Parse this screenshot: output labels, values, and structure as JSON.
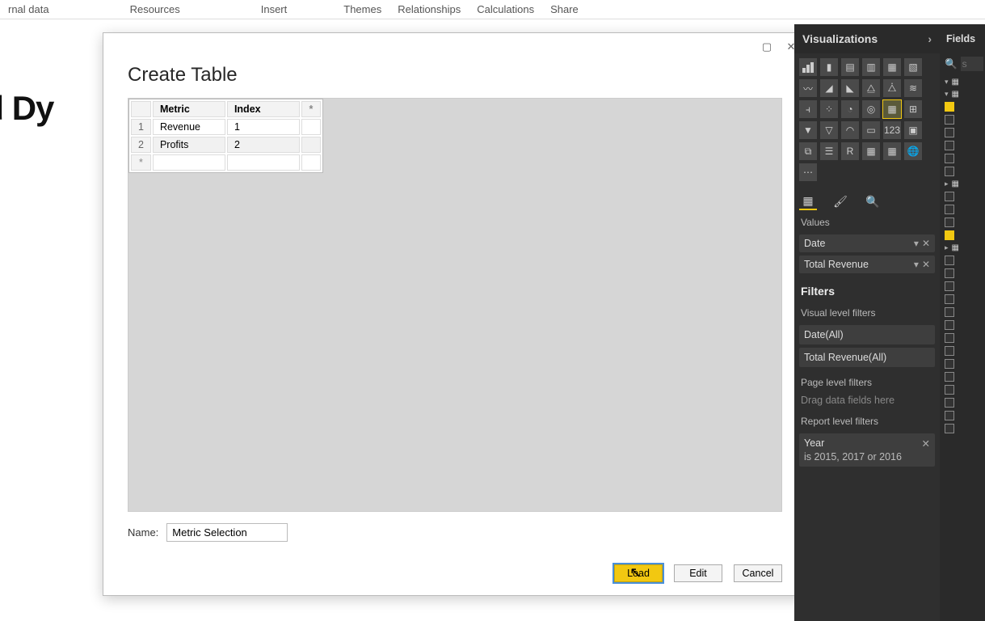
{
  "ribbon": {
    "items": [
      "rnal data",
      "Resources",
      "Insert",
      "Themes",
      "Relationships",
      "Calculations",
      "Share"
    ]
  },
  "background": {
    "title_fragment": "aded Dy"
  },
  "dialog": {
    "title": "Create Table",
    "columns": [
      "Metric",
      "Index"
    ],
    "rows": [
      {
        "n": "1",
        "metric": "Revenue",
        "index": "1"
      },
      {
        "n": "2",
        "metric": "Profits",
        "index": "2"
      }
    ],
    "star": "*",
    "name_label": "Name:",
    "name_value": "Metric Selection",
    "buttons": {
      "load": "Load",
      "edit": "Edit",
      "cancel": "Cancel"
    }
  },
  "viz": {
    "header": "Visualizations",
    "values_label": "Values",
    "fields": [
      {
        "label": "Date"
      },
      {
        "label": "Total Revenue"
      }
    ],
    "filters_title": "Filters",
    "visual_filters_label": "Visual level filters",
    "visual_filters": [
      "Date(All)",
      "Total Revenue(All)"
    ],
    "page_filters_label": "Page level filters",
    "page_placeholder": "Drag data fields here",
    "report_filters_label": "Report level filters",
    "report_filter": {
      "name": "Year",
      "desc": "is 2015, 2017 or 2016"
    }
  },
  "fields": {
    "header": "Fields",
    "search_placeholder": "s"
  }
}
